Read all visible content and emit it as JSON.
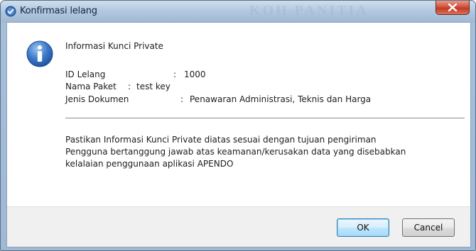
{
  "window": {
    "title": "Konfirmasi lelang",
    "watermark": "KOH PANITIA"
  },
  "message": {
    "heading": "Informasi Kunci Private",
    "fields": [
      {
        "label": "ID Lelang",
        "separator": ":",
        "value": "1000"
      },
      {
        "label": "Nama Paket",
        "separator": ":",
        "value": "test key"
      },
      {
        "label": "Jenis Dokumen",
        "separator": ":",
        "value": "Penawaran Administrasi, Teknis dan Harga"
      }
    ],
    "notes": [
      "Pastikan Informasi Kunci Private diatas sesuai dengan tujuan pengiriman",
      "Pengguna bertanggung jawab atas keamanan/kerusakan data yang disebabkan",
      "kelalaian penggunaan aplikasi APENDO"
    ]
  },
  "buttons": {
    "ok_label": "OK",
    "cancel_label": "Cancel"
  },
  "icons": {
    "title_icon": "check-shield-icon",
    "message_icon": "info-icon",
    "close_icon": "close-icon"
  },
  "colors": {
    "title_bar": "#a9c1da",
    "close_button": "#c74a33",
    "info_icon": "#2e66b5",
    "ok_accent": "#3c7fb1"
  }
}
